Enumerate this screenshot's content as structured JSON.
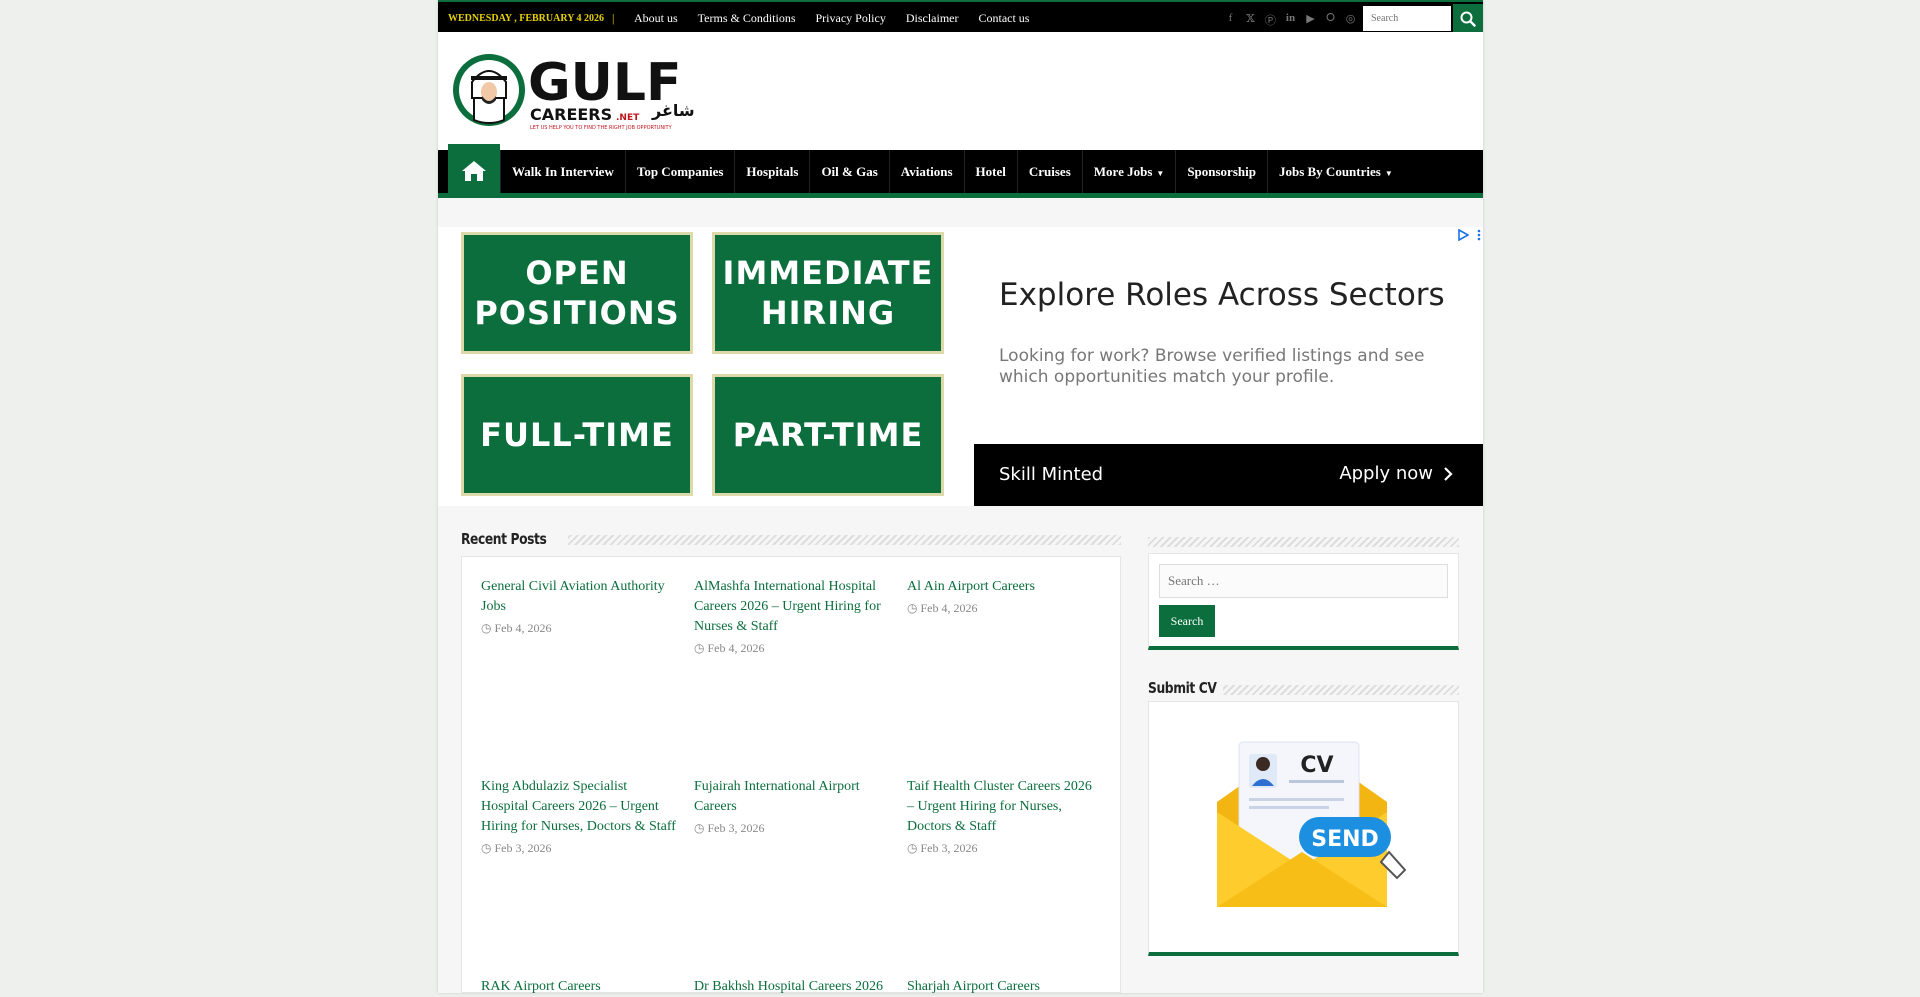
{
  "topbar": {
    "date": "WEDNESDAY , FEBRUARY 4 2026",
    "separator": "|",
    "links": [
      "About us",
      "Terms & Conditions",
      "Privacy Policy",
      "Disclaimer",
      "Contact us"
    ],
    "social": [
      "facebook-icon",
      "twitter-icon",
      "pinterest-icon",
      "linkedin-icon",
      "youtube-icon",
      "share-icon",
      "instagram-icon"
    ],
    "search_placeholder": "Search"
  },
  "logo": {
    "wordmark": "GULF",
    "sub": "CAREERS",
    "tld": ".NET",
    "tagline": "LET US HELP YOU TO FIND THE RIGHT JOB OPPORTUNITY",
    "arabic": "شاغر"
  },
  "nav": {
    "items": [
      {
        "label": " Walk In Interview",
        "caret": false
      },
      {
        "label": "Top Companies",
        "caret": false
      },
      {
        "label": "Hospitals",
        "caret": false
      },
      {
        "label": "Oil & Gas",
        "caret": false
      },
      {
        "label": "Aviations",
        "caret": false
      },
      {
        "label": "Hotel",
        "caret": false
      },
      {
        "label": "Cruises",
        "caret": false
      },
      {
        "label": " More Jobs",
        "caret": true
      },
      {
        "label": "Sponsorship",
        "caret": false
      },
      {
        "label": "Jobs By Countries",
        "caret": true
      }
    ]
  },
  "ad": {
    "tiles": [
      "OPEN POSITIONS",
      "IMMEDIATE HIRING",
      "FULL-TIME",
      "PART-TIME"
    ],
    "title": "Explore Roles Across Sectors",
    "description": "Looking for work? Browse verified listings and see which opportunities match your profile.",
    "brand": "Skill Minted",
    "cta": "Apply now"
  },
  "recent": {
    "title": "Recent Posts",
    "posts": [
      {
        "title": "General Civil Aviation Authority Jobs",
        "date": "Feb 4, 2026"
      },
      {
        "title": "AlMashfa International Hospital Careers 2026 – Urgent Hiring for Nurses & Staff",
        "date": "Feb 4, 2026"
      },
      {
        "title": "Al Ain Airport Careers",
        "date": "Feb 4, 2026"
      },
      {
        "title": "King Abdulaziz Specialist Hospital Careers 2026 – Urgent Hiring for Nurses, Doctors & Staff",
        "date": "Feb 3, 2026"
      },
      {
        "title": "Fujairah International Airport Careers",
        "date": "Feb 3, 2026"
      },
      {
        "title": "Taif Health Cluster Careers 2026 – Urgent Hiring for Nurses, Doctors & Staff",
        "date": "Feb 3, 2026"
      },
      {
        "title": "RAK Airport Careers",
        "date": ""
      },
      {
        "title": "Dr Bakhsh Hospital Careers 2026",
        "date": ""
      },
      {
        "title": "Sharjah Airport Careers",
        "date": ""
      }
    ]
  },
  "sidebar": {
    "search_placeholder": "Search …",
    "search_button": "Search",
    "submit_cv_title": "Submit CV",
    "cv_label": "CV",
    "send_label": "SEND"
  }
}
